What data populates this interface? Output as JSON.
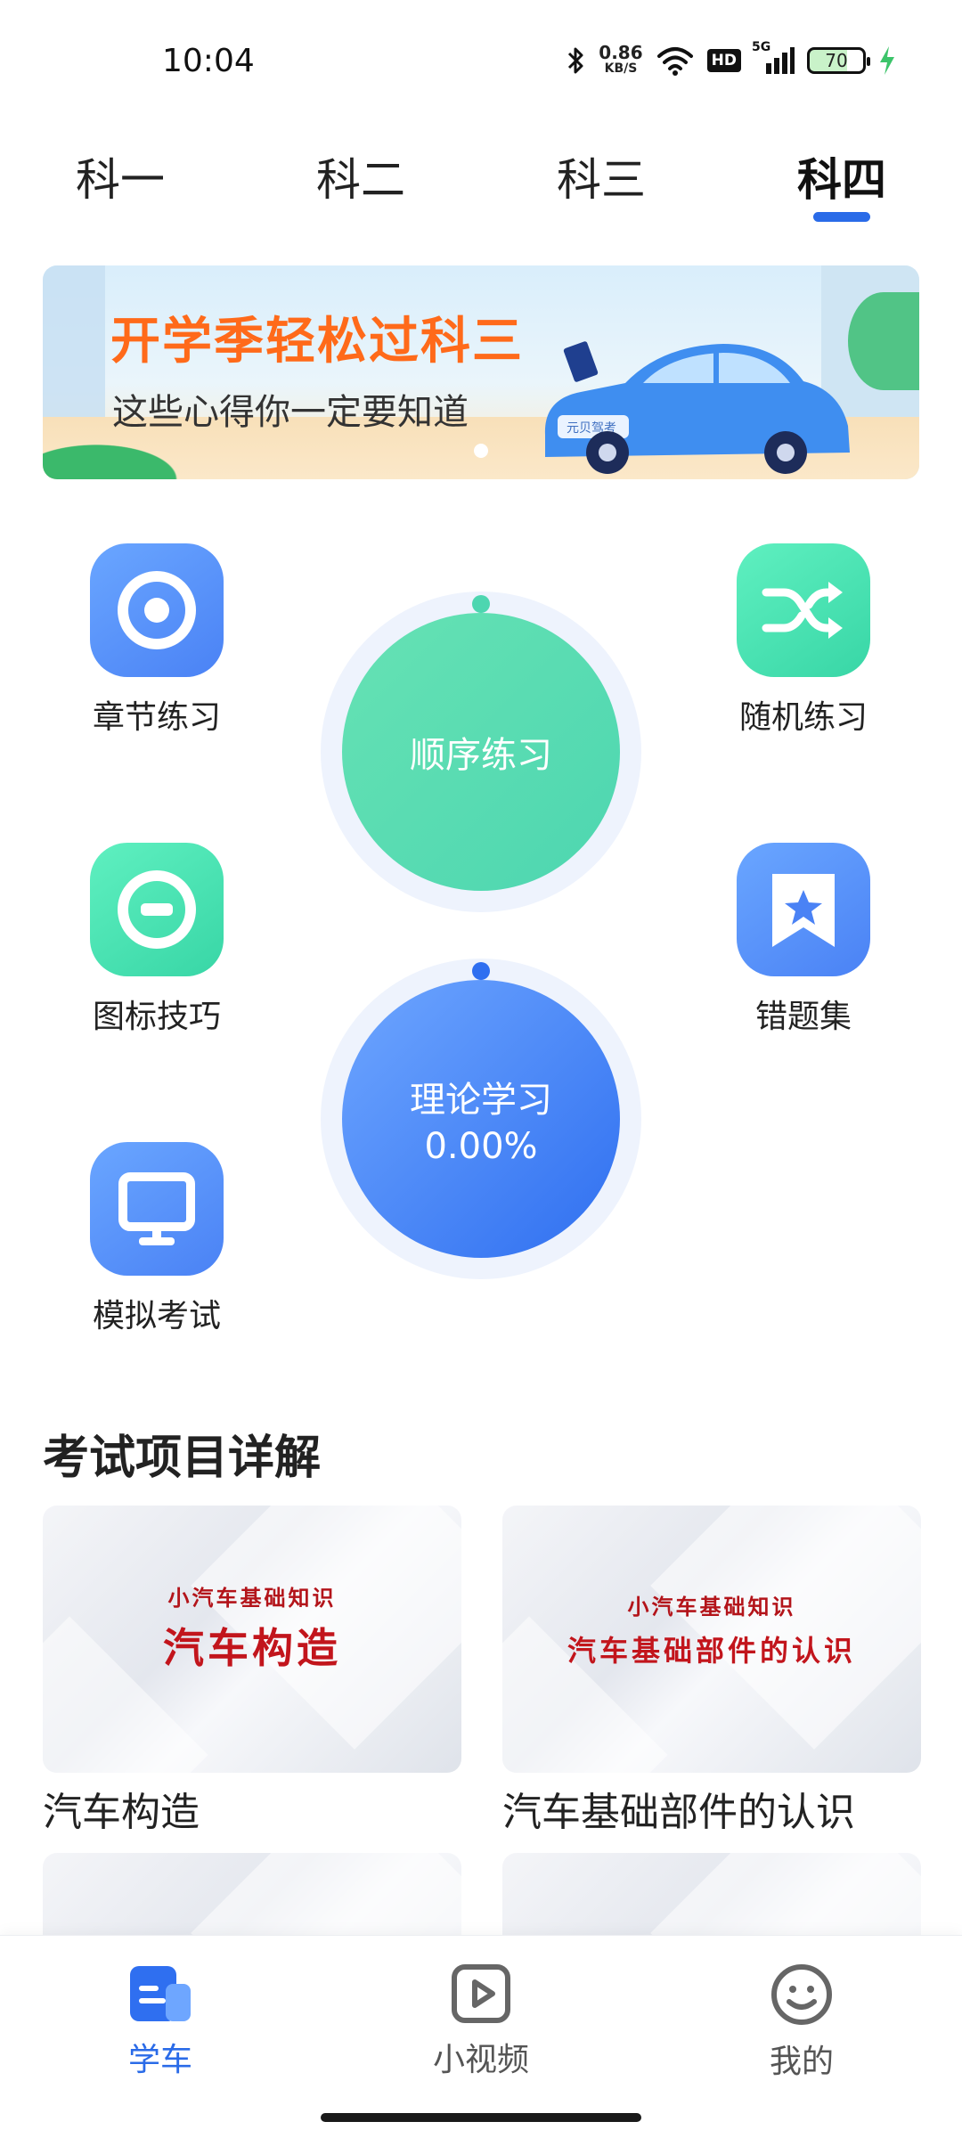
{
  "status_bar": {
    "time": "10:04",
    "net_speed_value": "0.86",
    "net_speed_unit": "KB/S",
    "hd": "HD",
    "signal": "5G",
    "battery": "70"
  },
  "tabs": [
    {
      "label": "科一",
      "active": false
    },
    {
      "label": "科二",
      "active": false
    },
    {
      "label": "科三",
      "active": false
    },
    {
      "label": "科四",
      "active": true
    }
  ],
  "banner": {
    "title": "开学季轻松过科三",
    "subtitle": "这些心得你一定要知道",
    "car_plate": "元贝驾考"
  },
  "features": {
    "chapter": "章节练习",
    "random": "随机练习",
    "signs": "图标技巧",
    "wrong": "错题集",
    "mock": "模拟考试"
  },
  "circles": {
    "sequence": {
      "label": "顺序练习"
    },
    "theory": {
      "label": "理论学习",
      "percent": "0.00%"
    }
  },
  "section": {
    "title": "考试项目详解",
    "cards": [
      {
        "thumb_sub": "小汽车基础知识",
        "thumb_main": "汽车构造",
        "title": "汽车构造"
      },
      {
        "thumb_sub": "小汽车基础知识",
        "thumb_main": "汽车基础部件的认识",
        "title": "汽车基础部件的认识"
      }
    ]
  },
  "bottom_nav": {
    "learn": "学车",
    "video": "小视频",
    "mine": "我的"
  },
  "colors": {
    "accent": "#2a6be8",
    "green": "#4dd6b0",
    "orange": "#ff6a1a",
    "thumb_red": "#c2151c"
  }
}
